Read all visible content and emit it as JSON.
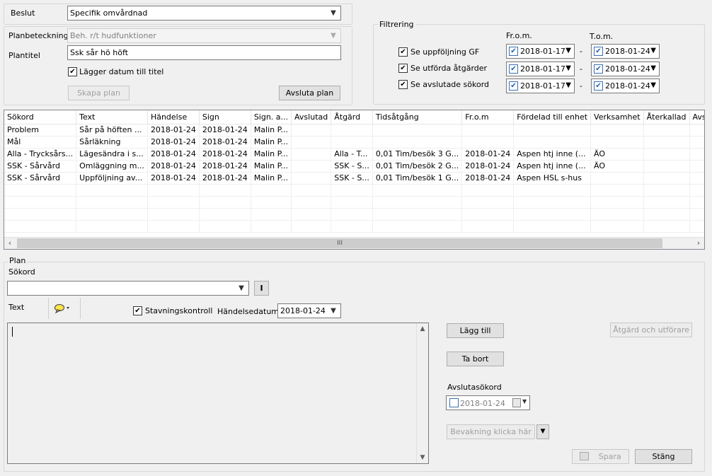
{
  "top": {
    "beslut_label": "Beslut",
    "beslut_value": "Specifik omvårdnad",
    "planbeteckning_label": "Planbeteckning",
    "planbeteckning_value": "Beh. r/t hudfunktioner",
    "plantitel_label": "Plantitel",
    "plantitel_value": "Ssk sår hö höft",
    "lagger_datum_label": "Lägger datum till titel",
    "skapa_plan_label": "Skapa plan",
    "avsluta_plan_label": "Avsluta plan"
  },
  "filter": {
    "title": "Filtrering",
    "from_header": "Fr.o.m.",
    "tom_header": "T.o.m.",
    "dash": "-",
    "rows": [
      {
        "label": "Se uppföljning GF",
        "from": "2018-01-17",
        "to": "2018-01-24"
      },
      {
        "label": "Se utförda åtgärder",
        "from": "2018-01-17",
        "to": "2018-01-24"
      },
      {
        "label": "Se avslutade sökord",
        "from": "2018-01-17",
        "to": "2018-01-24"
      }
    ]
  },
  "grid": {
    "columns": [
      "Sökord",
      "Text",
      "Händelse",
      "Sign",
      "Sign. a...",
      "Avslutad",
      "Åtgärd",
      "Tidsåtgång",
      "Fr.o.m",
      "Fördelad till enhet",
      "Verksamhet",
      "Återkallad",
      "Avs"
    ],
    "rows": [
      [
        "Problem",
        "Sår på höften ...",
        "2018-01-24",
        "2018-01-24",
        "Malin P...",
        "",
        "",
        "",
        "",
        "",
        "",
        "",
        ""
      ],
      [
        "Mål",
        "Sårläkning",
        "2018-01-24",
        "2018-01-24",
        "Malin P...",
        "",
        "",
        "",
        "",
        "",
        "",
        "",
        ""
      ],
      [
        "Alla - Trycksårs...",
        "Lägesändra i s...",
        "2018-01-24",
        "2018-01-24",
        "Malin P...",
        "",
        "Alla - T...",
        "0,01 Tim/besök 3 G...",
        "2018-01-24",
        "Aspen htj inne (...",
        "ÄO",
        "",
        ""
      ],
      [
        "SSK - Sårvård",
        "Omläggning m...",
        "2018-01-24",
        "2018-01-24",
        "Malin P...",
        "",
        "SSK - S...",
        "0,01 Tim/besök 2 G...",
        "2018-01-24",
        "Aspen htj inne (...",
        "ÄO",
        "",
        ""
      ],
      [
        "SSK - Sårvård",
        "Uppföljning av...",
        "2018-01-24",
        "2018-01-24",
        "Malin P...",
        "",
        "SSK - S...",
        "0,01 Tim/besök 1 G...",
        "2018-01-24",
        "Aspen HSL s-hus",
        "",
        "",
        ""
      ]
    ],
    "scroll_grip": "III"
  },
  "plan": {
    "title": "Plan",
    "sokord_label": "Sökord",
    "sokord_value": "",
    "i_button": "I",
    "text_label": "Text",
    "stavning_label": "Stavningskontroll",
    "handelsedatum_label": "Händelsedatum",
    "handelsedatum_value": "2018-01-24",
    "lagg_till_label": "Lägg till",
    "ta_bort_label": "Ta bort",
    "atgard_label": "Åtgärd och utförare",
    "avsluta_sokord_label": "Avslutasökord",
    "avsluta_sokord_date": "2018-01-24",
    "bevakning_label": "Bevakning klicka här",
    "spara_label": "Spara",
    "stang_label": "Stäng"
  }
}
